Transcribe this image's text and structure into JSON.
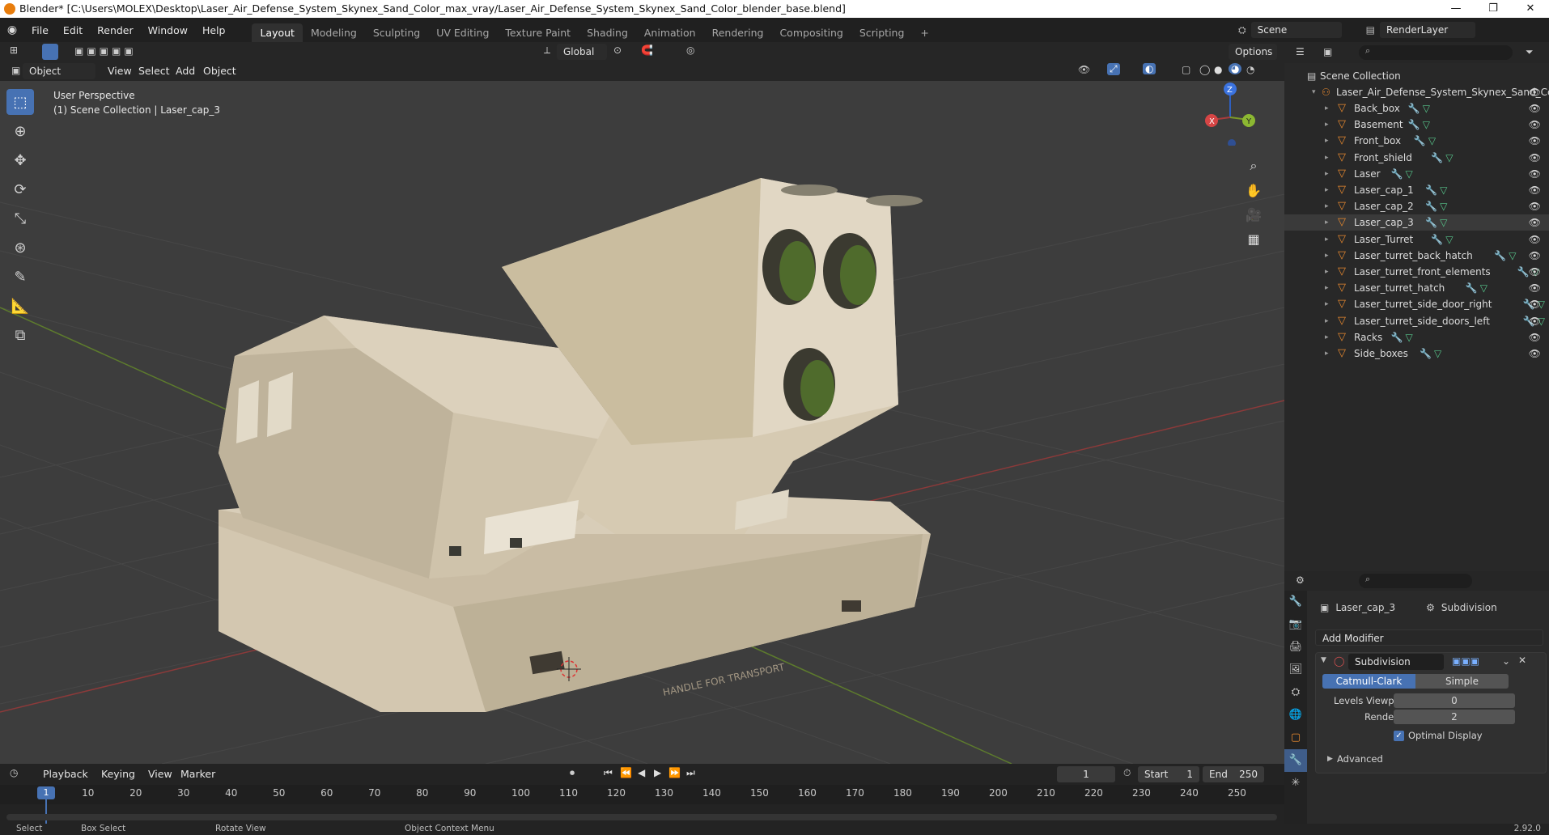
{
  "window": {
    "title": "Blender* [C:\\Users\\MOLEX\\Desktop\\Laser_Air_Defense_System_Skynex_Sand_Color_max_vray/Laser_Air_Defense_System_Skynex_Sand_Color_blender_base.blend]",
    "min": "—",
    "max": "❐",
    "close": "✕"
  },
  "menu": {
    "items": [
      "File",
      "Edit",
      "Render",
      "Window",
      "Help"
    ]
  },
  "workspaces": {
    "tabs": [
      "Layout",
      "Modeling",
      "Sculpting",
      "UV Editing",
      "Texture Paint",
      "Shading",
      "Animation",
      "Rendering",
      "Compositing",
      "Scripting"
    ],
    "active": "Layout",
    "add": "+"
  },
  "scene": {
    "name": "Scene",
    "view_layer": "RenderLayer"
  },
  "viewport_header": {
    "transform_orientation": "Global",
    "options": "Options",
    "mode": "Object Mode",
    "menus": [
      "View",
      "Select",
      "Add",
      "Object"
    ]
  },
  "viewport": {
    "perspective": "User Perspective",
    "context": "(1) Scene Collection | Laser_cap_3",
    "gizmo": {
      "x": "X",
      "y": "Y",
      "z": "Z"
    },
    "decal": "HANDLE FOR TRANSPORT"
  },
  "outliner": {
    "root": "Scene Collection",
    "collection": "Laser_Air_Defense_System_Skynex_Sand_Cc",
    "selected": "Laser_cap_3",
    "items": [
      "Back_box",
      "Basement",
      "Front_box",
      "Front_shield",
      "Laser",
      "Laser_cap_1",
      "Laser_cap_2",
      "Laser_cap_3",
      "Laser_Turret",
      "Laser_turret_back_hatch",
      "Laser_turret_front_elements",
      "Laser_turret_hatch",
      "Laser_turret_side_door_right",
      "Laser_turret_side_doors_left",
      "Racks",
      "Side_boxes"
    ]
  },
  "properties": {
    "object": "Laser_cap_3",
    "modifier_tab": "Subdivision",
    "add_modifier": "Add Modifier",
    "modifier_name": "Subdivision",
    "type_options": [
      "Catmull-Clark",
      "Simple"
    ],
    "active_type": "Catmull-Clark",
    "levels_viewport_label": "Levels Viewport",
    "levels_viewport": "0",
    "render_label": "Render",
    "render": "2",
    "optimal_display": "Optimal Display",
    "advanced": "Advanced"
  },
  "timeline": {
    "menus": [
      "Playback",
      "Keying",
      "View",
      "Marker"
    ],
    "current_frame": "1",
    "start_label": "Start",
    "start": "1",
    "end_label": "End",
    "end": "250",
    "ticks": [
      "1",
      "10",
      "20",
      "30",
      "40",
      "50",
      "60",
      "70",
      "80",
      "90",
      "100",
      "110",
      "120",
      "130",
      "140",
      "150",
      "160",
      "170",
      "180",
      "190",
      "200",
      "210",
      "220",
      "230",
      "240",
      "250"
    ]
  },
  "statusbar": {
    "items": [
      "Select",
      "Box Select",
      "Rotate View",
      "Object Context Menu"
    ],
    "version": "2.92.0"
  }
}
